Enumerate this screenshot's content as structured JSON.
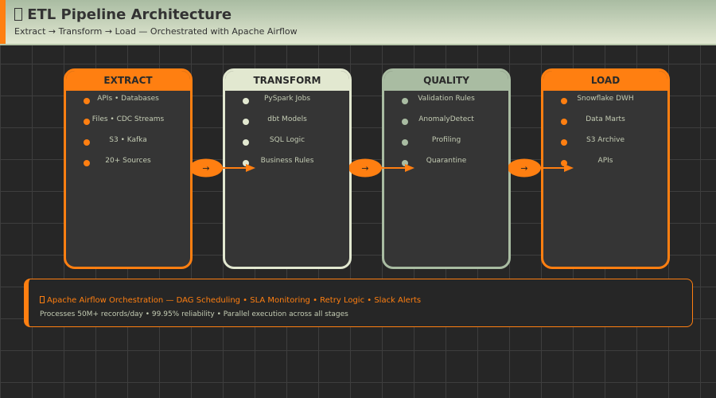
{
  "header": {
    "icon": "missing-emoji-glyph",
    "title": "ETL Pipeline Architecture",
    "subtitle": "Extract → Transform → Load — Orchestrated with Apache Airflow"
  },
  "colors": {
    "orange": "#ff7f11",
    "cream": "#e2e8d2",
    "sage": "#a9bca2",
    "panel": "#353535",
    "background": "#262626"
  },
  "stages": [
    {
      "title": "EXTRACT",
      "color": "#ff7f11",
      "items": [
        "APIs • Databases",
        "Files • CDC Streams",
        "S3 • Kafka",
        "20+ Sources"
      ]
    },
    {
      "title": "TRANSFORM",
      "color": "#e2e8d0",
      "items": [
        "PySpark Jobs",
        "dbt Models",
        "SQL Logic",
        "Business Rules"
      ]
    },
    {
      "title": "QUALITY",
      "color": "#a9bca2",
      "items": [
        "Validation Rules",
        "AnomalyDetect",
        "Profiling",
        "Quarantine"
      ]
    },
    {
      "title": "LOAD",
      "color": "#ff7f11",
      "items": [
        "Snowflake DWH",
        "Data Marts",
        "S3 Archive",
        "APIs"
      ]
    }
  ],
  "connector_label": "→",
  "footer": {
    "icon": "missing-emoji-glyph",
    "line1": "Apache Airflow Orchestration — DAG Scheduling • SLA Monitoring •  Retry Logic • Slack Alerts",
    "line2": "Processes 50M+ records/day • 99.95% reliability • Parallel execution across all stages"
  }
}
